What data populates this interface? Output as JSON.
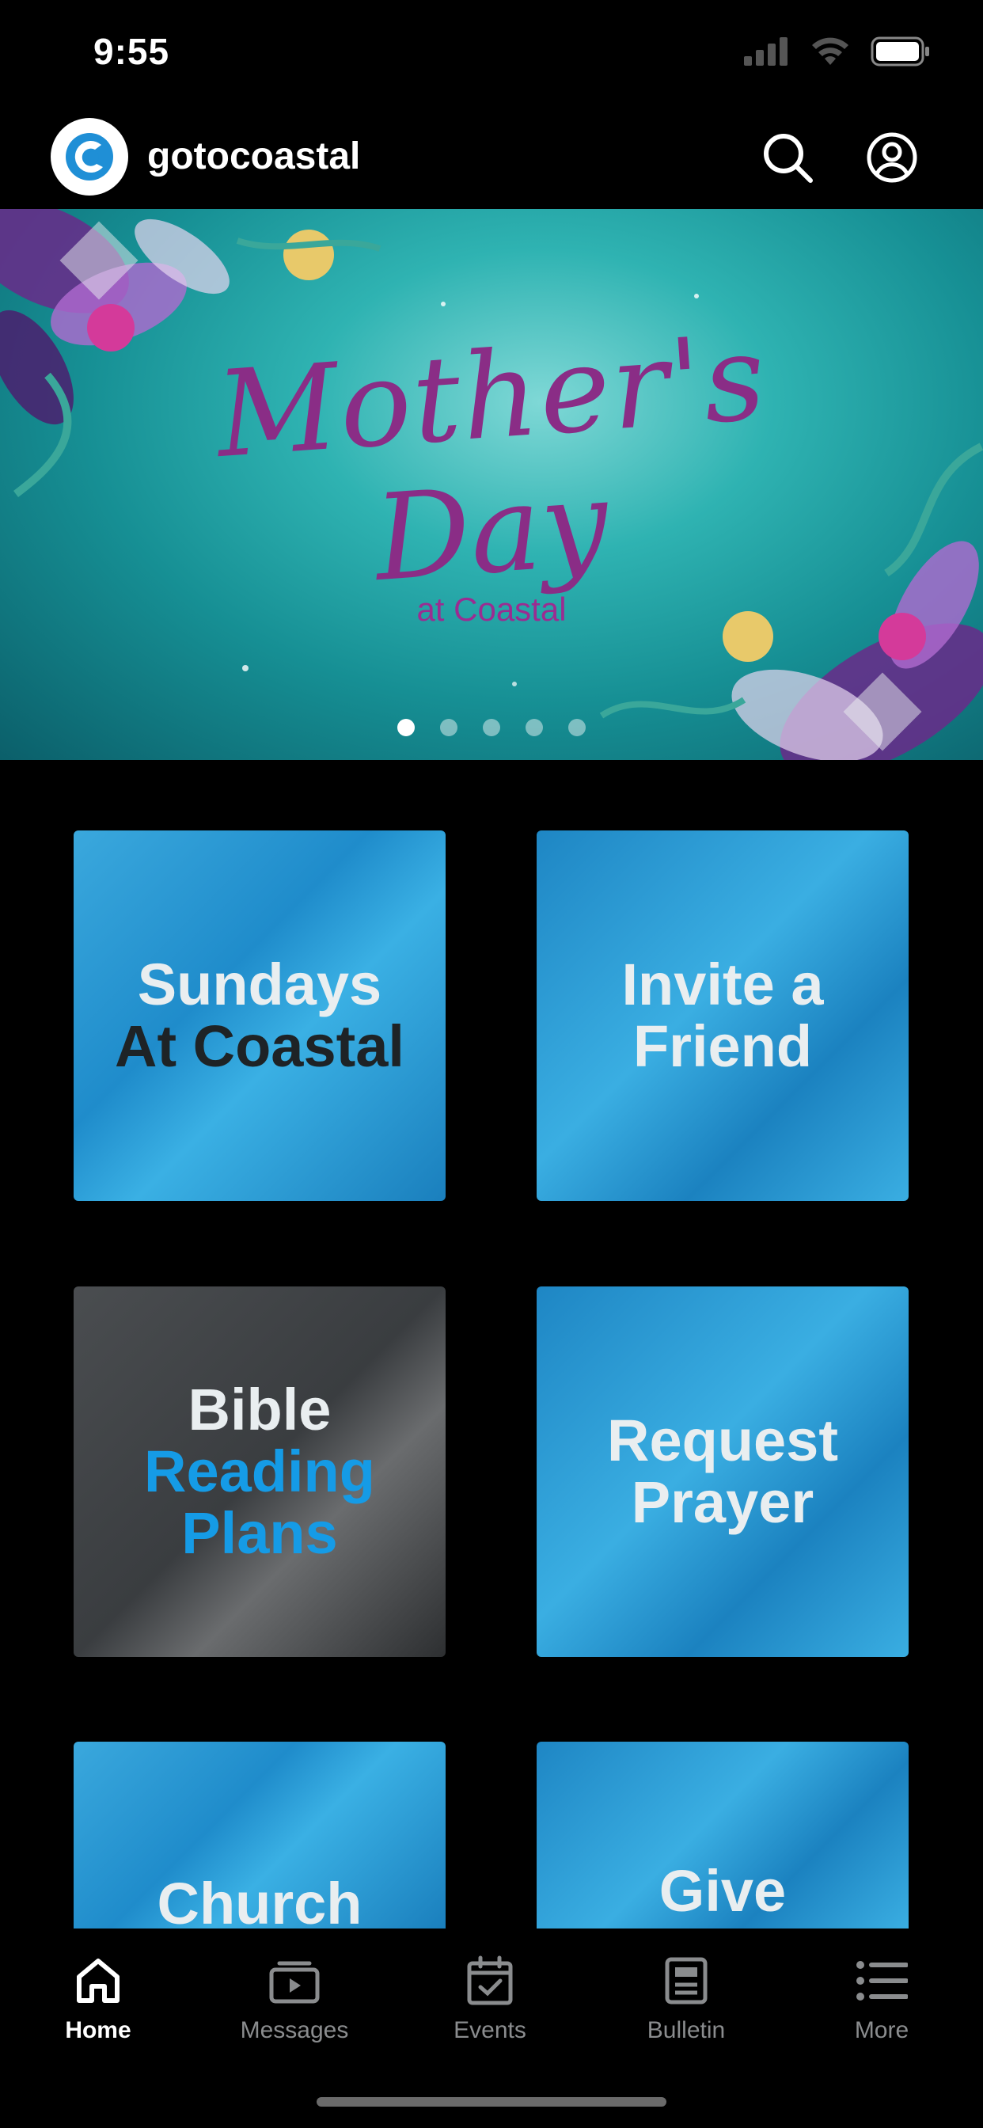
{
  "status": {
    "time": "9:55"
  },
  "header": {
    "brand": "gotocoastal"
  },
  "banner": {
    "line1": "Mother's",
    "line2": "Day",
    "line3": "at Coastal",
    "slides": 5,
    "active_slide": 1
  },
  "tiles": [
    {
      "lines": [
        "Sundays",
        "At Coastal"
      ]
    },
    {
      "lines": [
        "Invite a",
        "Friend"
      ]
    },
    {
      "lines": [
        "Bible",
        "Reading",
        "Plans"
      ]
    },
    {
      "lines": [
        "Request",
        "Prayer"
      ]
    },
    {
      "lines": [
        "Church"
      ]
    },
    {
      "lines": [
        "Give"
      ]
    }
  ],
  "tabs": [
    {
      "label": "Home",
      "icon": "home-icon"
    },
    {
      "label": "Messages",
      "icon": "messages-icon"
    },
    {
      "label": "Events",
      "icon": "calendar-icon"
    },
    {
      "label": "Bulletin",
      "icon": "bulletin-icon"
    },
    {
      "label": "More",
      "icon": "list-icon"
    }
  ],
  "colors": {
    "accent_blue": "#159be6",
    "tile_blue": "#2a9ad6",
    "banner_text": "#8a2d86"
  }
}
